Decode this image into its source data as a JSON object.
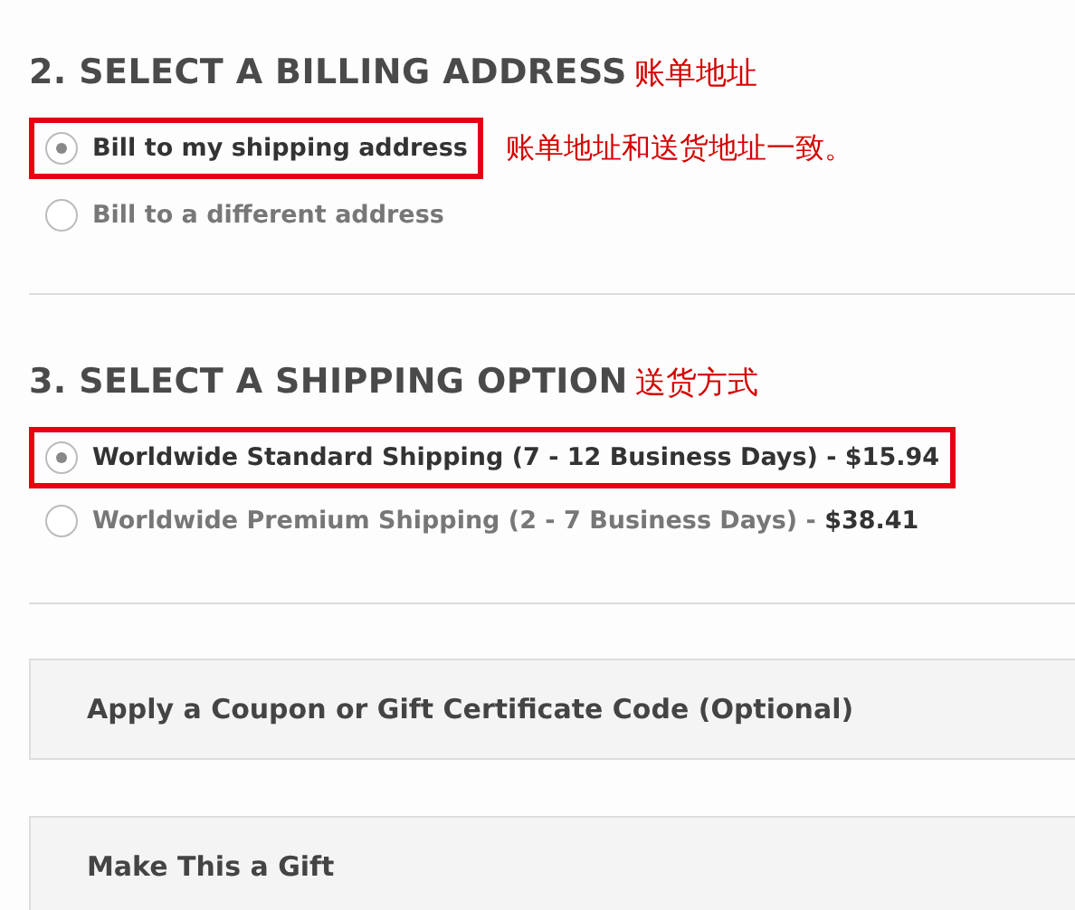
{
  "sections": [
    {
      "heading": "2. SELECT A BILLING ADDRESS",
      "note": "账单地址",
      "options": [
        {
          "label": "Bill to my shipping address",
          "selected": true,
          "highlighted": true,
          "note": "账单地址和送货地址一致。"
        },
        {
          "label": "Bill to a different address",
          "selected": false,
          "highlighted": false
        }
      ]
    },
    {
      "heading": "3. SELECT A SHIPPING OPTION",
      "note": "送货方式",
      "options": [
        {
          "label": "Worldwide Standard Shipping (7 - 12 Business Days) -",
          "price": "$15.94",
          "selected": true,
          "highlighted": true
        },
        {
          "label": "Worldwide Premium Shipping (2 - 7 Business Days) -",
          "price": "$38.41",
          "selected": false,
          "highlighted": false
        }
      ]
    }
  ],
  "panels": [
    {
      "title": "Apply a Coupon or Gift Certificate Code (Optional)"
    },
    {
      "title": "Make This a Gift"
    }
  ]
}
